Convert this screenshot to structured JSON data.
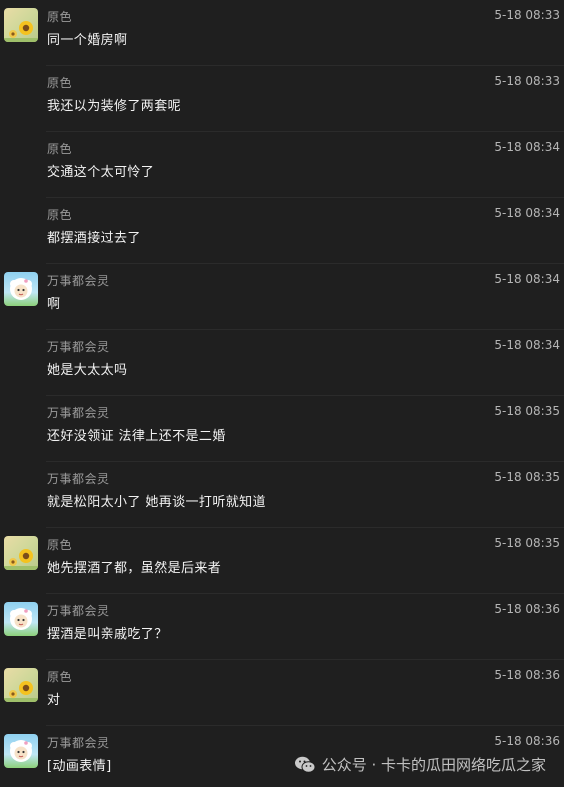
{
  "messages": [
    {
      "sender": "原色",
      "time": "5-18 08:33",
      "text": "同一个婚房啊",
      "avatar": "sunflower-avatar"
    },
    {
      "sender": "原色",
      "time": "5-18 08:33",
      "text": "我还以为装修了两套呢",
      "avatar": null
    },
    {
      "sender": "原色",
      "time": "5-18 08:34",
      "text": "交通这个太可怜了",
      "avatar": null
    },
    {
      "sender": "原色",
      "time": "5-18 08:34",
      "text": "都摆酒接过去了",
      "avatar": null
    },
    {
      "sender": "万事都会灵",
      "time": "5-18 08:34",
      "text": "啊",
      "avatar": "sheep-avatar"
    },
    {
      "sender": "万事都会灵",
      "time": "5-18 08:34",
      "text": "她是大太太吗",
      "avatar": null
    },
    {
      "sender": "万事都会灵",
      "time": "5-18 08:35",
      "text": "还好没领证 法律上还不是二婚",
      "avatar": null
    },
    {
      "sender": "万事都会灵",
      "time": "5-18 08:35",
      "text": "就是松阳太小了 她再谈一打听就知道",
      "avatar": null
    },
    {
      "sender": "原色",
      "time": "5-18 08:35",
      "text": "她先摆酒了都，虽然是后来者",
      "avatar": "sunflower-avatar"
    },
    {
      "sender": "万事都会灵",
      "time": "5-18 08:36",
      "text": "摆酒是叫亲戚吃了？",
      "avatar": "sheep-avatar"
    },
    {
      "sender": "原色",
      "time": "5-18 08:36",
      "text": "对",
      "avatar": "sunflower-avatar"
    },
    {
      "sender": "万事都会灵",
      "time": "5-18 08:36",
      "text": "[动画表情]",
      "avatar": "sheep-avatar"
    }
  ],
  "watermark": {
    "icon": "wechat-icon",
    "text": "公众号 · 卡卡的瓜田网络吃瓜之家"
  }
}
